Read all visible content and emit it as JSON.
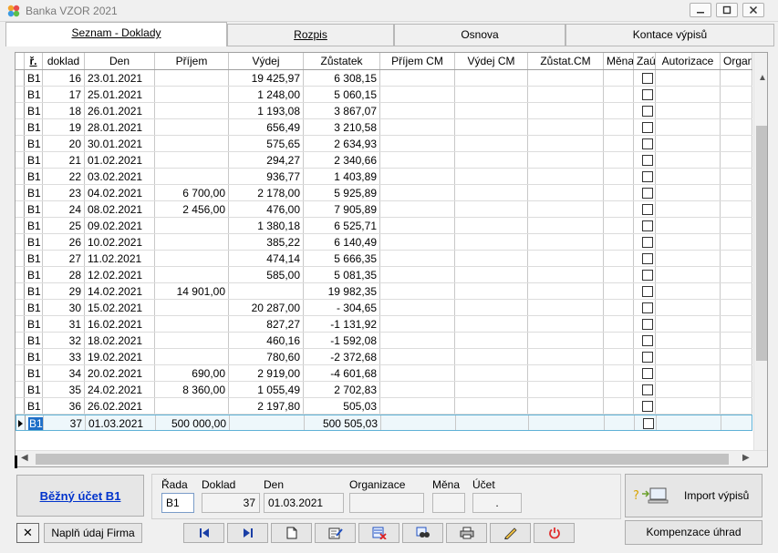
{
  "window": {
    "title": "Banka VZOR  2021"
  },
  "tabs": [
    {
      "label": "Seznam - Doklady",
      "active": true
    },
    {
      "label": "Rozpis",
      "active": false
    },
    {
      "label": "Osnova",
      "active": false
    },
    {
      "label": "Kontace výpisů",
      "active": false
    }
  ],
  "grid": {
    "columns": [
      "ř.",
      "doklad",
      "Den",
      "Příjem",
      "Výdej",
      "Zůstatek",
      "Příjem CM",
      "Výdej CM",
      "Zůstat.CM",
      "Měna",
      "Zaú",
      "Autorizace",
      "Organ"
    ],
    "rows": [
      {
        "rada": "B1",
        "doklad": "16",
        "den": "23.01.2021",
        "prijem": "",
        "vydej": "19 425,97",
        "zustatek": "6 308,15"
      },
      {
        "rada": "B1",
        "doklad": "17",
        "den": "25.01.2021",
        "prijem": "",
        "vydej": "1 248,00",
        "zustatek": "5 060,15"
      },
      {
        "rada": "B1",
        "doklad": "18",
        "den": "26.01.2021",
        "prijem": "",
        "vydej": "1 193,08",
        "zustatek": "3 867,07"
      },
      {
        "rada": "B1",
        "doklad": "19",
        "den": "28.01.2021",
        "prijem": "",
        "vydej": "656,49",
        "zustatek": "3 210,58"
      },
      {
        "rada": "B1",
        "doklad": "20",
        "den": "30.01.2021",
        "prijem": "",
        "vydej": "575,65",
        "zustatek": "2 634,93"
      },
      {
        "rada": "B1",
        "doklad": "21",
        "den": "01.02.2021",
        "prijem": "",
        "vydej": "294,27",
        "zustatek": "2 340,66"
      },
      {
        "rada": "B1",
        "doklad": "22",
        "den": "03.02.2021",
        "prijem": "",
        "vydej": "936,77",
        "zustatek": "1 403,89"
      },
      {
        "rada": "B1",
        "doklad": "23",
        "den": "04.02.2021",
        "prijem": "6 700,00",
        "vydej": "2 178,00",
        "zustatek": "5 925,89"
      },
      {
        "rada": "B1",
        "doklad": "24",
        "den": "08.02.2021",
        "prijem": "2 456,00",
        "vydej": "476,00",
        "zustatek": "7 905,89"
      },
      {
        "rada": "B1",
        "doklad": "25",
        "den": "09.02.2021",
        "prijem": "",
        "vydej": "1 380,18",
        "zustatek": "6 525,71"
      },
      {
        "rada": "B1",
        "doklad": "26",
        "den": "10.02.2021",
        "prijem": "",
        "vydej": "385,22",
        "zustatek": "6 140,49"
      },
      {
        "rada": "B1",
        "doklad": "27",
        "den": "11.02.2021",
        "prijem": "",
        "vydej": "474,14",
        "zustatek": "5 666,35"
      },
      {
        "rada": "B1",
        "doklad": "28",
        "den": "12.02.2021",
        "prijem": "",
        "vydej": "585,00",
        "zustatek": "5 081,35"
      },
      {
        "rada": "B1",
        "doklad": "29",
        "den": "14.02.2021",
        "prijem": "14 901,00",
        "vydej": "",
        "zustatek": "19 982,35"
      },
      {
        "rada": "B1",
        "doklad": "30",
        "den": "15.02.2021",
        "prijem": "",
        "vydej": "20 287,00",
        "zustatek": "- 304,65"
      },
      {
        "rada": "B1",
        "doklad": "31",
        "den": "16.02.2021",
        "prijem": "",
        "vydej": "827,27",
        "zustatek": "-1 131,92"
      },
      {
        "rada": "B1",
        "doklad": "32",
        "den": "18.02.2021",
        "prijem": "",
        "vydej": "460,16",
        "zustatek": "-1 592,08"
      },
      {
        "rada": "B1",
        "doklad": "33",
        "den": "19.02.2021",
        "prijem": "",
        "vydej": "780,60",
        "zustatek": "-2 372,68"
      },
      {
        "rada": "B1",
        "doklad": "34",
        "den": "20.02.2021",
        "prijem": "690,00",
        "vydej": "2 919,00",
        "zustatek": "-4 601,68"
      },
      {
        "rada": "B1",
        "doklad": "35",
        "den": "24.02.2021",
        "prijem": "8 360,00",
        "vydej": "1 055,49",
        "zustatek": "2 702,83"
      },
      {
        "rada": "B1",
        "doklad": "36",
        "den": "26.02.2021",
        "prijem": "",
        "vydej": "2 197,80",
        "zustatek": "505,03"
      },
      {
        "rada": "B1",
        "doklad": "37",
        "den": "01.03.2021",
        "prijem": "500 000,00",
        "vydej": "",
        "zustatek": "500 505,03",
        "selected": true
      }
    ]
  },
  "account_button": {
    "label": "Běžný účet B1"
  },
  "fields": {
    "rada": {
      "label": "Řada",
      "value": "B1"
    },
    "doklad": {
      "label": "Doklad",
      "value": "37"
    },
    "den": {
      "label": "Den",
      "value": "01.03.2021"
    },
    "organizace": {
      "label": "Organizace",
      "value": ""
    },
    "mena": {
      "label": "Měna",
      "value": ""
    },
    "ucet": {
      "label": "Účet",
      "value": "."
    }
  },
  "buttons": {
    "import": "Import výpisů",
    "kompenzace": "Kompenzace úhrad",
    "naplnit_firma": "Naplň údaj Firma",
    "clear": "✕"
  },
  "colors": {
    "accent": "#0033cc",
    "selection": "#1e6fc8",
    "power": "#e03030"
  }
}
